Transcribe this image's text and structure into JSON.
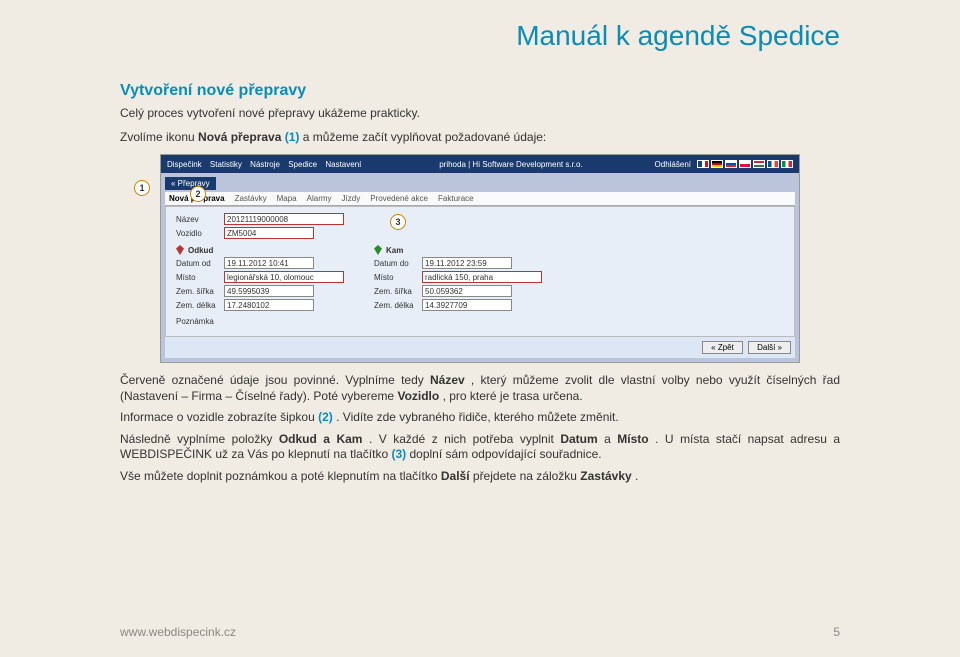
{
  "doc": {
    "title": "Manuál k agendě Spedice",
    "section_title": "Vytvoření nové přepravy",
    "intro_line1": "Celý proces vytvoření nové přepravy ukážeme prakticky.",
    "intro_line2_pre": "Zvolíme ikonu ",
    "intro_line2_bold": "Nová přeprava",
    "intro_line2_ref": "(1)",
    "intro_line2_post": "  a můžeme začít vyplňovat požadované údaje:",
    "footer_url": "www.webdispecink.cz",
    "page_num": "5"
  },
  "markers": {
    "m1": "1",
    "m2": "2",
    "m3": "3"
  },
  "shot": {
    "menu": {
      "dispecink": "Dispečink",
      "statistiky": "Statistiky",
      "nastroje": "Nástroje",
      "spedice": "Spedice",
      "nastaveni": "Nastavení"
    },
    "user": "prihoda | Hi Software Development s.r.o.",
    "logout": "Odhlášení",
    "crumb": "« Přepravy",
    "tabs": {
      "nova": "Nová přeprava",
      "zastavky": "Zastávky",
      "mapa": "Mapa",
      "alarmy": "Alarmy",
      "jizdy": "Jízdy",
      "provedene": "Provedené akce",
      "fakturace": "Fakturace"
    },
    "labels": {
      "nazev": "Název",
      "vozidlo": "Vozidlo",
      "odkud": "Odkud",
      "kam": "Kam",
      "datum_od": "Datum od",
      "datum_do": "Datum do",
      "misto": "Místo",
      "sirka": "Zem. šířka",
      "delka": "Zem. délka",
      "poznamka": "Poznámka"
    },
    "values": {
      "nazev": "20121119000008",
      "vozidlo": "ZM5004",
      "datum_od": "19.11.2012 10:41",
      "datum_do": "19.11.2012 23:59",
      "misto_od": "legionářská 10, olomouc",
      "misto_do": "radlická 150, praha",
      "sirka_od": "49.5995039",
      "sirka_do": "50.059362",
      "delka_od": "17.2480102",
      "delka_do": "14.3927709"
    },
    "buttons": {
      "zpet": "« Zpět",
      "dalsi": "Další »"
    }
  },
  "body": {
    "p1_a": "Červeně označené údaje jsou povinné. Vyplníme tedy ",
    "p1_b1": "Název",
    "p1_b": ", který můžeme zvolit dle vlastní volby nebo využít číselných řad (Nastavení – Firma – Číselné řady). Poté vybereme ",
    "p1_b2": "Vozidlo",
    "p1_c": ", pro které je trasa určena.",
    "p2_a": "Informace o vozidle zobrazíte šipkou ",
    "p2_ref": "(2)",
    "p2_b": ". Vidíte zde vybraného řidiče, kterého můžete změnit.",
    "p3_a": "Následně vyplníme položky ",
    "p3_b1": "Odkud a Kam",
    "p3_b": ". V každé z nich potřeba vyplnit ",
    "p3_b2": "Datum",
    "p3_c": " a ",
    "p3_b3": "Místo",
    "p3_d": ". U místa stačí napsat adresu a WEBDISPEČINK už za Vás po klepnutí na tlačítko ",
    "p3_ref": "(3)",
    "p3_e": " doplní sám odpovídající souřadnice.",
    "p4_a": "Vše můžete doplnit poznámkou a poté klepnutím na tlačítko ",
    "p4_b1": "Další",
    "p4_b": " přejdete na záložku ",
    "p4_b2": "Zastávky",
    "p4_c": "."
  }
}
